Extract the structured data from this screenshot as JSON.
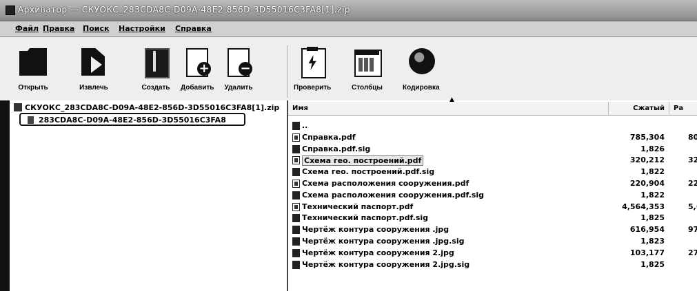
{
  "window": {
    "title": "Архиватор — СКУОКС_283CDA8C-D09A-48E2-856D-3D55016C3FA8[1].zip"
  },
  "menu": {
    "items": [
      "Файл",
      "Правка",
      "Поиск",
      "Настройки",
      "Справка"
    ]
  },
  "toolbar": {
    "buttons": [
      {
        "label": "Открыть",
        "icon": "folder-icon",
        "has_dropdown": true
      },
      {
        "label": "Извлечь",
        "icon": "extract-icon",
        "has_dropdown": true
      },
      {
        "label": "Создать",
        "icon": "archive-icon",
        "has_dropdown": false
      },
      {
        "label": "Добавить",
        "icon": "add-file-icon",
        "has_dropdown": false
      },
      {
        "label": "Удалить",
        "icon": "delete-file-icon",
        "has_dropdown": false
      },
      {
        "label": "Проверить",
        "icon": "test-icon",
        "has_dropdown": false
      },
      {
        "label": "Столбцы",
        "icon": "columns-icon",
        "has_dropdown": false
      },
      {
        "label": "Кодировка",
        "icon": "globe-icon",
        "has_dropdown": false
      }
    ]
  },
  "tree": {
    "root": "СКУОКС_283CDA8C-D09A-48E2-856D-3D55016C3FA8[1].zip",
    "child": "283CDA8C-D09A-48E2-856D-3D55016C3FA8"
  },
  "file_list": {
    "columns": {
      "name": "Имя",
      "compressed": "Сжатый",
      "original": "Ра"
    },
    "rows": [
      {
        "name": "..",
        "type": "up",
        "compressed": "",
        "original": ""
      },
      {
        "name": "Справка.pdf",
        "type": "pdf",
        "compressed": "785,304",
        "original": "80"
      },
      {
        "name": "Справка.pdf.sig",
        "type": "sig",
        "compressed": "1,826",
        "original": ""
      },
      {
        "name": "Схема гео. построений.pdf",
        "type": "pdf",
        "compressed": "320,212",
        "original": "32"
      },
      {
        "name": "Схема гео. построений.pdf.sig",
        "type": "sig",
        "compressed": "1,822",
        "original": ""
      },
      {
        "name": "Схема расположения сооружения.pdf",
        "type": "pdf",
        "compressed": "220,904",
        "original": "22"
      },
      {
        "name": "Схема расположения сооружения.pdf.sig",
        "type": "sig",
        "compressed": "1,822",
        "original": ""
      },
      {
        "name": "Технический паспорт.pdf",
        "type": "pdf",
        "compressed": "4,564,353",
        "original": "5,60"
      },
      {
        "name": "Технический паспорт.pdf.sig",
        "type": "sig",
        "compressed": "1,825",
        "original": ""
      },
      {
        "name": "Чертёж контура сооружения .jpg",
        "type": "jpg",
        "compressed": "616,954",
        "original": "97"
      },
      {
        "name": "Чертёж контура сооружения .jpg.sig",
        "type": "sig",
        "compressed": "1,823",
        "original": ""
      },
      {
        "name": "Чертёж контура сооружения 2.jpg",
        "type": "jpg",
        "compressed": "103,177",
        "original": "27"
      },
      {
        "name": "Чертёж контура сооружения 2.jpg.sig",
        "type": "sig",
        "compressed": "1,825",
        "original": ""
      }
    ],
    "selected_row": 3
  }
}
